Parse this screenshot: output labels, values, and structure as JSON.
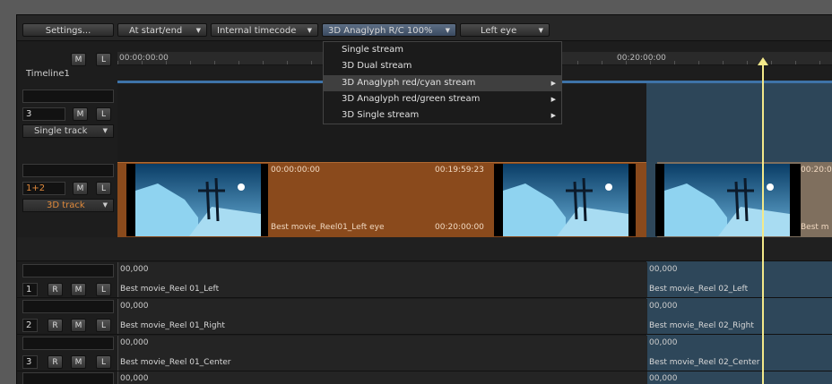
{
  "toolbar": {
    "settings": "Settings...",
    "start_end": "At start/end",
    "timecode": "Internal timecode",
    "stereo_mode": "3D Anaglyph R/C 100%",
    "eye": "Left eye"
  },
  "stream_menu": {
    "items": [
      {
        "label": "Single stream",
        "submenu": false,
        "selected": false
      },
      {
        "label": "3D Dual stream",
        "submenu": false,
        "selected": false
      },
      {
        "label": "3D Anaglyph red/cyan stream",
        "submenu": true,
        "selected": true
      },
      {
        "label": "3D Anaglyph red/green stream",
        "submenu": true,
        "selected": false
      },
      {
        "label": "3D Single stream",
        "submenu": true,
        "selected": false
      }
    ]
  },
  "timeline": {
    "name": "Timeline1",
    "ruler_start": "00:00:00:00",
    "ruler_mid": "00:20:00:00",
    "m": "M",
    "l": "L",
    "r": "R"
  },
  "tracks": {
    "single": {
      "index": "3",
      "mode": "Single track"
    },
    "three_d": {
      "index": "1+2",
      "mode": "3D track"
    }
  },
  "clip": {
    "tc_in": "00:00:00:00",
    "tc_dur": "00:19:59:23",
    "name": "Best movie_Reel01_Left eye",
    "tc_out": "00:20:00:00",
    "next_tc": "00:20:0",
    "next_name": "Best m"
  },
  "audio_tracks": [
    {
      "num": "1",
      "level": "00,000",
      "reel1": "Best movie_Reel 01_Left",
      "reel2": "Best movie_Reel 02_Left"
    },
    {
      "num": "2",
      "level": "00,000",
      "reel1": "Best movie_Reel 01_Right",
      "reel2": "Best movie_Reel 02_Right"
    },
    {
      "num": "3",
      "level": "00,000",
      "reel1": "Best movie_Reel 01_Center",
      "reel2": "Best movie_Reel 02_Center"
    },
    {
      "num": "",
      "level": "00,000",
      "reel1": "",
      "reel2": ""
    }
  ],
  "colors": {
    "clip_orange": "#8a4a1c",
    "selection_blue": "#2e4f66",
    "playhead": "#f3e98a",
    "menu_selected": "#3f3f3f"
  }
}
